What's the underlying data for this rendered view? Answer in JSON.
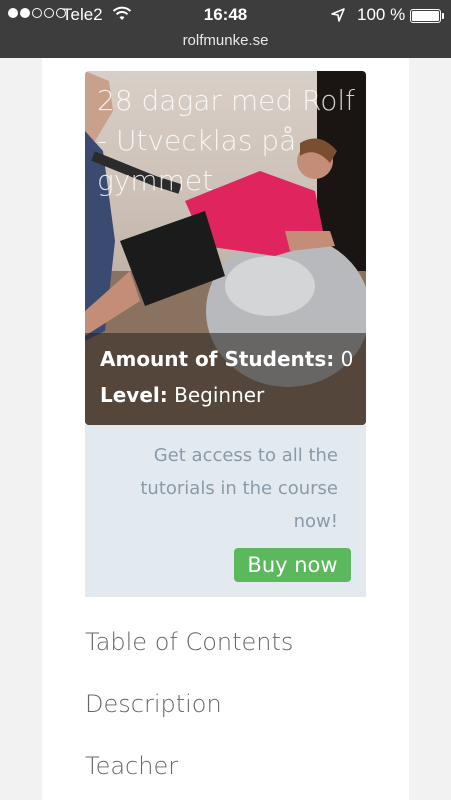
{
  "status": {
    "carrier": "Tele2",
    "time": "16:48",
    "battery": "100 %",
    "url": "rolfmunke.se"
  },
  "course": {
    "title": "28 dagar med Rolf - Utvecklas på gymmet",
    "students_label": "Amount of Students:",
    "students_value": "0",
    "level_label": "Level:",
    "level_value": "Beginner"
  },
  "promo": {
    "text": "Get access to all the tutorials in the course now!",
    "buy_label": "Buy now"
  },
  "nav": {
    "items": [
      "Table of Contents",
      "Description",
      "Teacher"
    ]
  },
  "colors": {
    "buy": "#5cb85c",
    "promo_bg": "#e2eaf0"
  }
}
